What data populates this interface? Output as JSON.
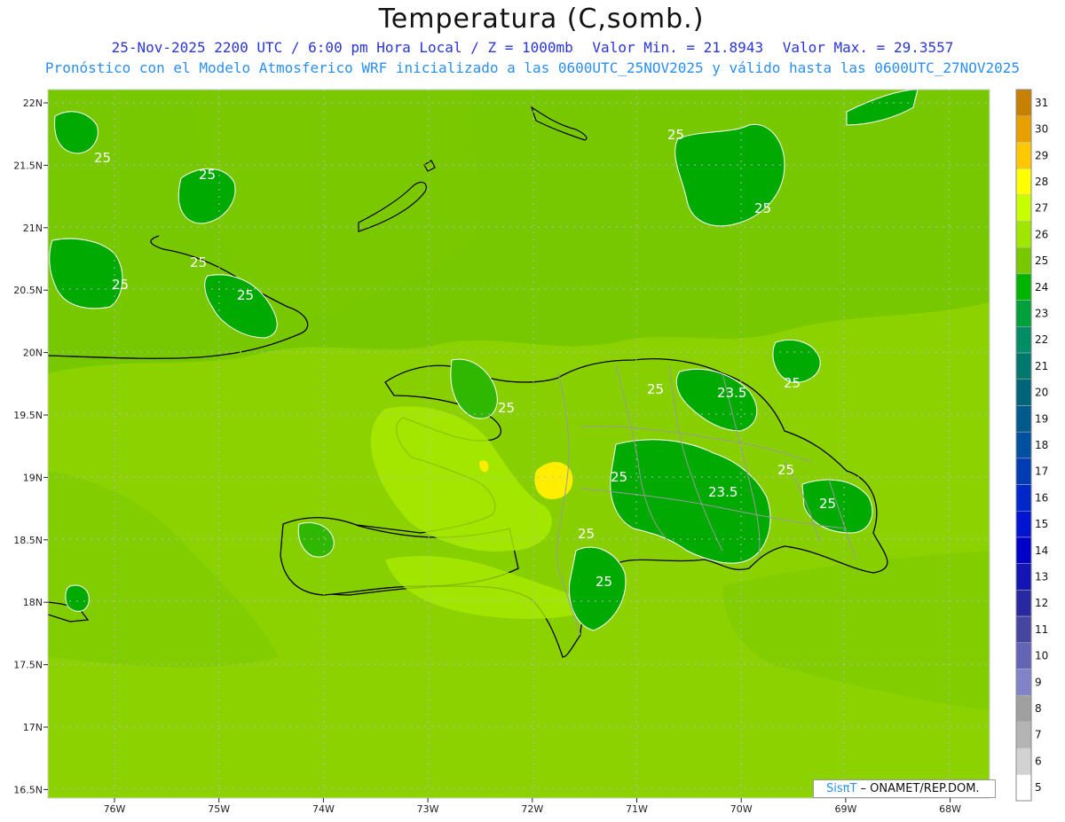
{
  "title": "Temperatura (C,somb.)",
  "subtitle": {
    "datetime": "25-Nov-2025 2200 UTC / 6:00 pm Hora Local / Z = 1000mb",
    "min": "Valor Min. = 21.8943",
    "max": "Valor Max. = 29.3557"
  },
  "forecast_note": "Pronóstico con el Modelo Atmosferico WRF inicializado a las 0600UTC_25NOV2025 y válido hasta las  0600UTC_27NOV2025",
  "credit": {
    "brand": "SisπΤ",
    "org": "– ONAMET/REP.DOM."
  },
  "axes": {
    "longitude_labels": [
      "76W",
      "75W",
      "74W",
      "73W",
      "72W",
      "71W",
      "70W",
      "69W",
      "68W"
    ],
    "latitude_labels": [
      "22N",
      "21.5N",
      "21N",
      "20.5N",
      "20N",
      "19.5N",
      "19N",
      "18.5N",
      "18N",
      "17.5N",
      "17N",
      "16.5N"
    ]
  },
  "contour_labels": [
    "25",
    "25",
    "25",
    "25",
    "25",
    "25",
    "25",
    "25",
    "25",
    "25",
    "25",
    "25",
    "25",
    "23.5",
    "23.5"
  ],
  "colorbar": {
    "labels": [
      "31",
      "30",
      "29",
      "28",
      "27",
      "26",
      "25",
      "24",
      "23",
      "22",
      "21",
      "20",
      "19",
      "18",
      "17",
      "16",
      "15",
      "14",
      "13",
      "12",
      "11",
      "10",
      "9",
      "8",
      "7",
      "6",
      "5"
    ],
    "colors": [
      "#c88000",
      "#e8a000",
      "#ffc800",
      "#ffff00",
      "#c8ff00",
      "#a0e600",
      "#78c800",
      "#00b400",
      "#00a03c",
      "#008c64",
      "#00786e",
      "#006478",
      "#005a8c",
      "#0050a0",
      "#003cb4",
      "#0028c8",
      "#0014d2",
      "#0000c8",
      "#1414b4",
      "#2828a0",
      "#4646a0",
      "#6464b4",
      "#8282c8",
      "#a0a0a0",
      "#b4b4b4",
      "#d2d2d2",
      "#ffffff"
    ]
  },
  "map_colors": {
    "sea_band_25": "#78c800",
    "band_26": "#8cd200",
    "band_27": "#aaee00",
    "band_28_29": "#ffee00",
    "band_24": "#00a800",
    "coastline": "#000000",
    "borders": "#9a9a9a"
  }
}
